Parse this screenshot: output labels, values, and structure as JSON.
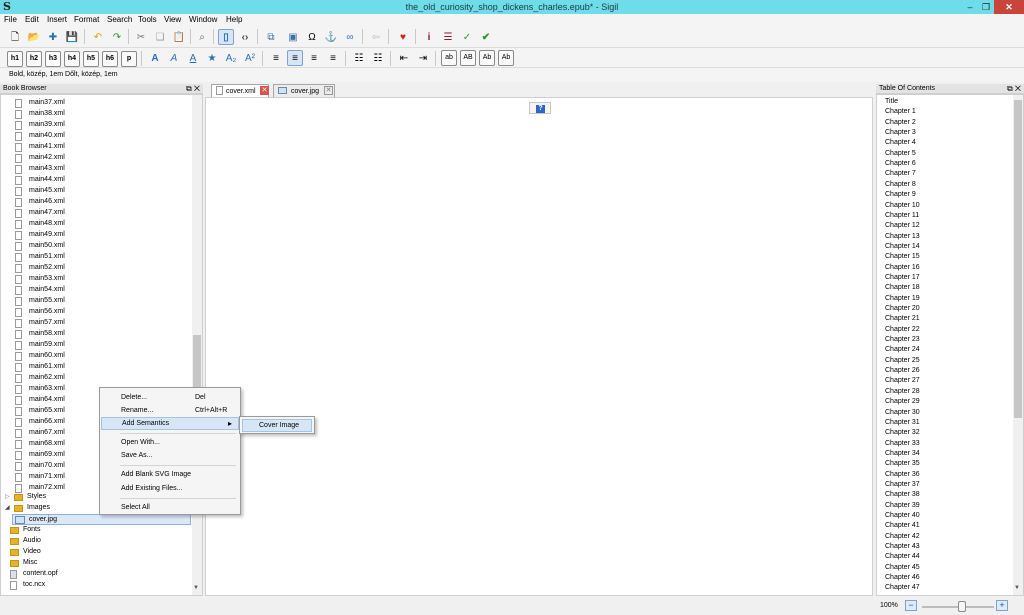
{
  "window": {
    "title": "the_old_curiosity_shop_dickens_charles.epub* - Sigil",
    "app_icon": "S",
    "buttons": [
      "minimize-icon",
      "restore-icon",
      "close-icon"
    ]
  },
  "menu": [
    "File",
    "Edit",
    "Insert",
    "Format",
    "Search",
    "Tools",
    "View",
    "Window",
    "Help"
  ],
  "toolbar2": {
    "headings": [
      "h1",
      "h2",
      "h3",
      "h4",
      "h5",
      "h6",
      "p"
    ],
    "case_buttons": [
      "ab",
      "AB",
      "Ab",
      "Ab"
    ]
  },
  "status_line": "Bold, közép, 1em   Dőlt, közép, 1em",
  "book_browser": {
    "title": "Book Browser",
    "files": [
      "main37.xml",
      "main38.xml",
      "main39.xml",
      "main40.xml",
      "main41.xml",
      "main42.xml",
      "main43.xml",
      "main44.xml",
      "main45.xml",
      "main46.xml",
      "main47.xml",
      "main48.xml",
      "main49.xml",
      "main50.xml",
      "main51.xml",
      "main52.xml",
      "main53.xml",
      "main54.xml",
      "main55.xml",
      "main56.xml",
      "main57.xml",
      "main58.xml",
      "main59.xml",
      "main60.xml",
      "main61.xml",
      "main62.xml",
      "main63.xml",
      "main64.xml",
      "main65.xml",
      "main66.xml",
      "main67.xml",
      "main68.xml",
      "main69.xml",
      "main70.xml",
      "main71.xml",
      "main72.xml"
    ],
    "folders": {
      "styles": "Styles",
      "images": "Images",
      "cover": "cover.jpg",
      "fonts": "Fonts",
      "audio": "Audio",
      "video": "Video",
      "misc": "Misc",
      "opf": "content.opf",
      "ncx": "toc.ncx"
    }
  },
  "tabs": [
    {
      "label": "cover.xml",
      "active": true
    },
    {
      "label": "cover.jpg",
      "active": false
    }
  ],
  "context_menu": {
    "delete": "Delete...",
    "delete_sc": "Del",
    "rename": "Rename...",
    "rename_sc": "Ctrl+Alt+R",
    "add_semantics": "Add Semantics",
    "open_with": "Open With...",
    "save_as": "Save As...",
    "add_blank_svg": "Add Blank SVG Image",
    "add_existing": "Add Existing Files...",
    "select_all": "Select All",
    "submenu_cover_image": "Cover Image"
  },
  "toc": {
    "title": "Table Of Contents",
    "items": [
      "Title",
      "Chapter 1",
      "Chapter 2",
      "Chapter 3",
      "Chapter 4",
      "Chapter 5",
      "Chapter 6",
      "Chapter 7",
      "Chapter 8",
      "Chapter 9",
      "Chapter 10",
      "Chapter 11",
      "Chapter 12",
      "Chapter 13",
      "Chapter 14",
      "Chapter 15",
      "Chapter 16",
      "Chapter 17",
      "Chapter 18",
      "Chapter 19",
      "Chapter 20",
      "Chapter 21",
      "Chapter 22",
      "Chapter 23",
      "Chapter 24",
      "Chapter 25",
      "Chapter 26",
      "Chapter 27",
      "Chapter 28",
      "Chapter 29",
      "Chapter 30",
      "Chapter 31",
      "Chapter 32",
      "Chapter 33",
      "Chapter 34",
      "Chapter 35",
      "Chapter 36",
      "Chapter 37",
      "Chapter 38",
      "Chapter 39",
      "Chapter 40",
      "Chapter 41",
      "Chapter 42",
      "Chapter 43",
      "Chapter 44",
      "Chapter 45",
      "Chapter 46",
      "Chapter 47"
    ]
  },
  "zoom": {
    "label": "100%",
    "minus": "−",
    "plus": "+"
  },
  "colors": {
    "titlebar": "#6fdce9",
    "close": "#c7453a",
    "highlight": "#d6e6f7"
  }
}
